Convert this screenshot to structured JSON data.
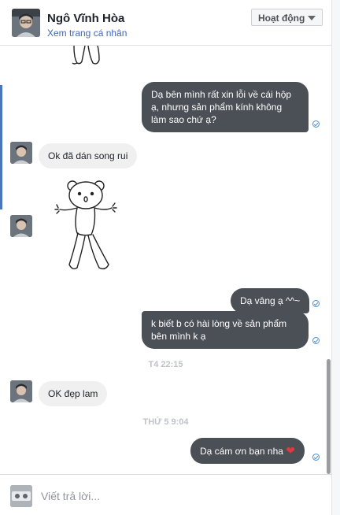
{
  "header": {
    "name": "Ngô Vĩnh Hòa",
    "profile_link": "Xem trang cá nhân",
    "status_button": "Hoạt động"
  },
  "messages": [
    {
      "from": "me",
      "text": "Dạ bên mình rất xin lỗi về cái hộp ạ, nhưng sản phẩm kính không làm sao chứ ạ?"
    },
    {
      "from": "them",
      "text": "Ok đã dán song rui"
    },
    {
      "from": "them",
      "sticker": "bear-sticker"
    },
    {
      "from": "me",
      "text": "Dạ vâng ạ ^^~"
    },
    {
      "from": "me",
      "text": "k biết b có hài lòng về sản phẩm bên mình k ạ"
    },
    {
      "timestamp": "T4 22:15"
    },
    {
      "from": "them",
      "text": "OK đẹp lam"
    },
    {
      "timestamp": "THỨ 5 9:04"
    },
    {
      "from": "me",
      "text": "Dạ cám ơn bạn nha",
      "emoji": "❤"
    }
  ],
  "composer": {
    "placeholder": "Viết trả lời..."
  },
  "colors": {
    "outgoing_bubble": "#4b4f56",
    "incoming_bubble": "#f1f0f0",
    "link": "#4267b2",
    "seen_indicator": "#4a90d9"
  }
}
